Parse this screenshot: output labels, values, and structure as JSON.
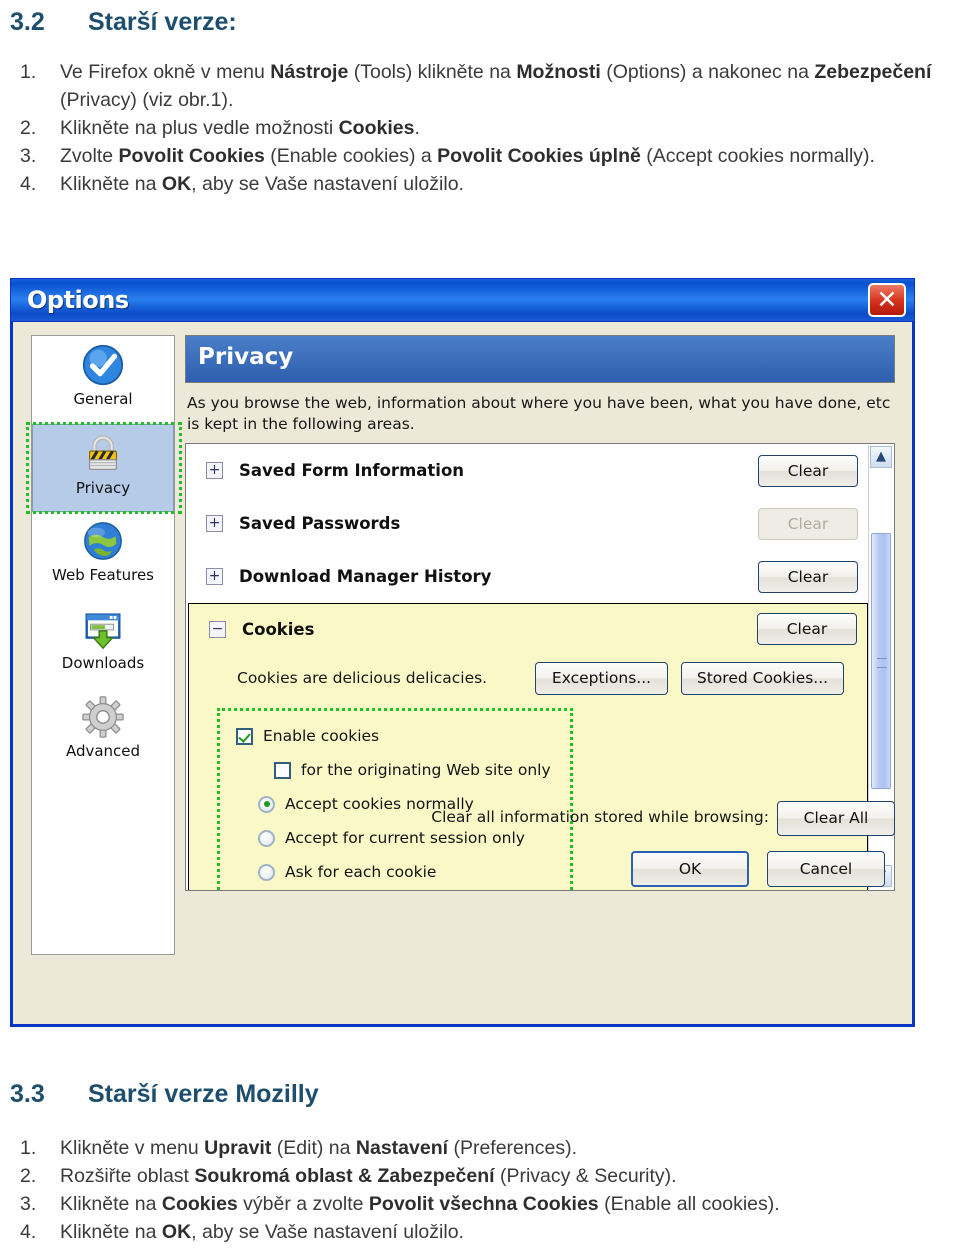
{
  "sections": [
    {
      "number": "3.2",
      "title": "Starší verze:",
      "steps": [
        {
          "marker": "1.",
          "html": "Ve Firefox okně v menu <b>Nástroje</b> (Tools) klikněte na <b>Možnosti</b> (Options) a nakonec na <b>Zebezpečení</b> (Privacy) (viz obr.1)."
        },
        {
          "marker": "2.",
          "html": "Klikněte na plus vedle možnosti <b>Cookies</b>."
        },
        {
          "marker": "3.",
          "html": "Zvolte <b>Povolit Cookies</b> (Enable cookies) a <b>Povolit Cookies úplně</b> (Accept cookies normally)."
        },
        {
          "marker": "4.",
          "html": "Klikněte na <b>OK</b>, aby se Vaše nastavení uložilo."
        }
      ]
    },
    {
      "number": "3.3",
      "title": "Starší verze  Mozilly",
      "steps": [
        {
          "marker": "1.",
          "html": "Klikněte v menu <b>Upravit</b> (Edit) na <b>Nastavení</b> (Preferences)."
        },
        {
          "marker": "2.",
          "html": "Rozšiřte oblast <b>Soukromá oblast &amp; Zabezpečení</b> (Privacy &amp; Security)."
        },
        {
          "marker": "3.",
          "html": "Klikněte na <b>Cookies</b> výběr a zvolte <b>Povolit všechna Cookies</b> (Enable all cookies)."
        },
        {
          "marker": "4.",
          "html": "Klikněte na <b>OK</b>, aby se Vaše nastavení uložilo."
        }
      ]
    }
  ],
  "dialog": {
    "title": "Options",
    "close_label": "✕",
    "sidebar": {
      "items": [
        {
          "label": "General",
          "icon": "check-circle-icon",
          "selected": false
        },
        {
          "label": "Privacy",
          "icon": "padlock-icon",
          "selected": true
        },
        {
          "label": "Web Features",
          "icon": "globe-icon",
          "selected": false
        },
        {
          "label": "Downloads",
          "icon": "download-window-icon",
          "selected": false
        },
        {
          "label": "Advanced",
          "icon": "gear-icon",
          "selected": false
        }
      ]
    },
    "pane": {
      "header": "Privacy",
      "description": "As you browse the web, information about where you have been, what you have done, etc is kept in the following areas.",
      "rows": [
        {
          "expander": "+",
          "label": "Saved Form Information",
          "button": "Clear",
          "disabled": false
        },
        {
          "expander": "+",
          "label": "Saved Passwords",
          "button": "Clear",
          "disabled": true
        },
        {
          "expander": "+",
          "label": "Download Manager History",
          "button": "Clear",
          "disabled": false
        }
      ],
      "cookies": {
        "expander": "−",
        "label": "Cookies",
        "clear_button": "Clear",
        "description": "Cookies are delicious delicacies.",
        "exceptions_button": "Exceptions...",
        "stored_button": "Stored Cookies...",
        "options": [
          {
            "type": "checkbox",
            "label": "Enable cookies",
            "checked": true,
            "indent": 0
          },
          {
            "type": "checkbox",
            "label": "for the originating Web site only",
            "checked": false,
            "indent": 1
          },
          {
            "type": "radio",
            "label": "Accept cookies normally",
            "checked": true,
            "indent": 2
          },
          {
            "type": "radio",
            "label": "Accept for current session only",
            "checked": false,
            "indent": 2
          },
          {
            "type": "radio",
            "label": "Ask for each cookie",
            "checked": false,
            "indent": 2
          }
        ]
      },
      "scrollbar": {
        "up": "▲",
        "down": "▼"
      }
    },
    "footer": {
      "clear_all_label": "Clear all information stored while browsing:",
      "clear_all_button": "Clear All",
      "ok_button": "OK",
      "cancel_button": "Cancel"
    }
  },
  "colors": {
    "heading": "#1d4e6e",
    "body_text": "#3b3b3b",
    "titlebar": "#0a4fd0",
    "pane_header": "#3a6ec0",
    "cookies_panel": "#fbf8c8",
    "highlight_dashed": "#22c022",
    "dialog_face": "#ece9d8"
  }
}
